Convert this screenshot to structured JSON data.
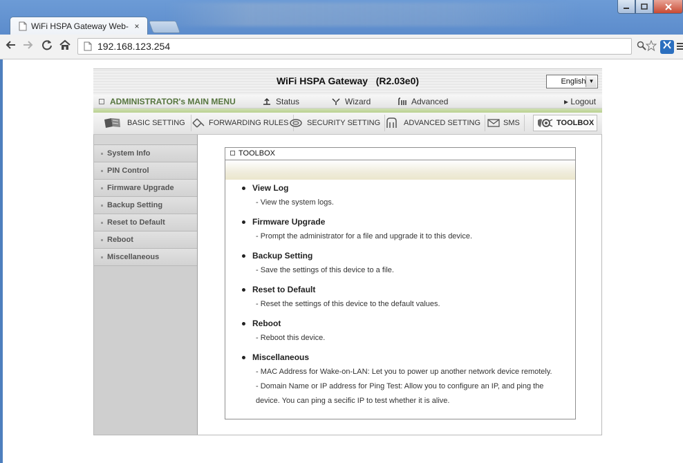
{
  "browser": {
    "tab_title": "WiFi HSPA Gateway Web-",
    "tab_close": "×",
    "url": "192.168.123.254"
  },
  "router": {
    "title": "WiFi HSPA Gateway   (R2.03e0)",
    "language": "English",
    "main_menu": {
      "admin": "ADMINISTRATOR's MAIN MENU",
      "status": "Status",
      "wizard": "Wizard",
      "advanced": "Advanced",
      "logout": "▸ Logout"
    },
    "categories": {
      "basic": "BASIC SETTING",
      "forwarding": "FORWARDING RULES",
      "security": "SECURITY SETTING",
      "advanced": "ADVANCED SETTING",
      "sms": "SMS",
      "toolbox": "TOOLBOX"
    },
    "sidebar": [
      "System Info",
      "PIN Control",
      "Firmware Upgrade",
      "Backup Setting",
      "Reset to Default",
      "Reboot",
      "Miscellaneous"
    ],
    "panel": {
      "title": "TOOLBOX",
      "entries": [
        {
          "title": "View Log",
          "lines": [
            "- View the system logs."
          ]
        },
        {
          "title": "Firmware Upgrade",
          "lines": [
            "- Prompt the administrator for a file and upgrade it to this device."
          ]
        },
        {
          "title": "Backup Setting",
          "lines": [
            "- Save the settings of this device to a file."
          ]
        },
        {
          "title": "Reset to Default",
          "lines": [
            "- Reset the settings of this device to the default values."
          ]
        },
        {
          "title": "Reboot",
          "lines": [
            "- Reboot this device."
          ]
        },
        {
          "title": "Miscellaneous",
          "lines": [
            "- MAC Address for Wake-on-LAN: Let you to power up another network device remotely.",
            "- Domain Name or IP address for Ping Test: Allow you to configure an IP, and ping the",
            "device. You can ping a secific IP to test whether it is alive."
          ]
        }
      ]
    }
  }
}
